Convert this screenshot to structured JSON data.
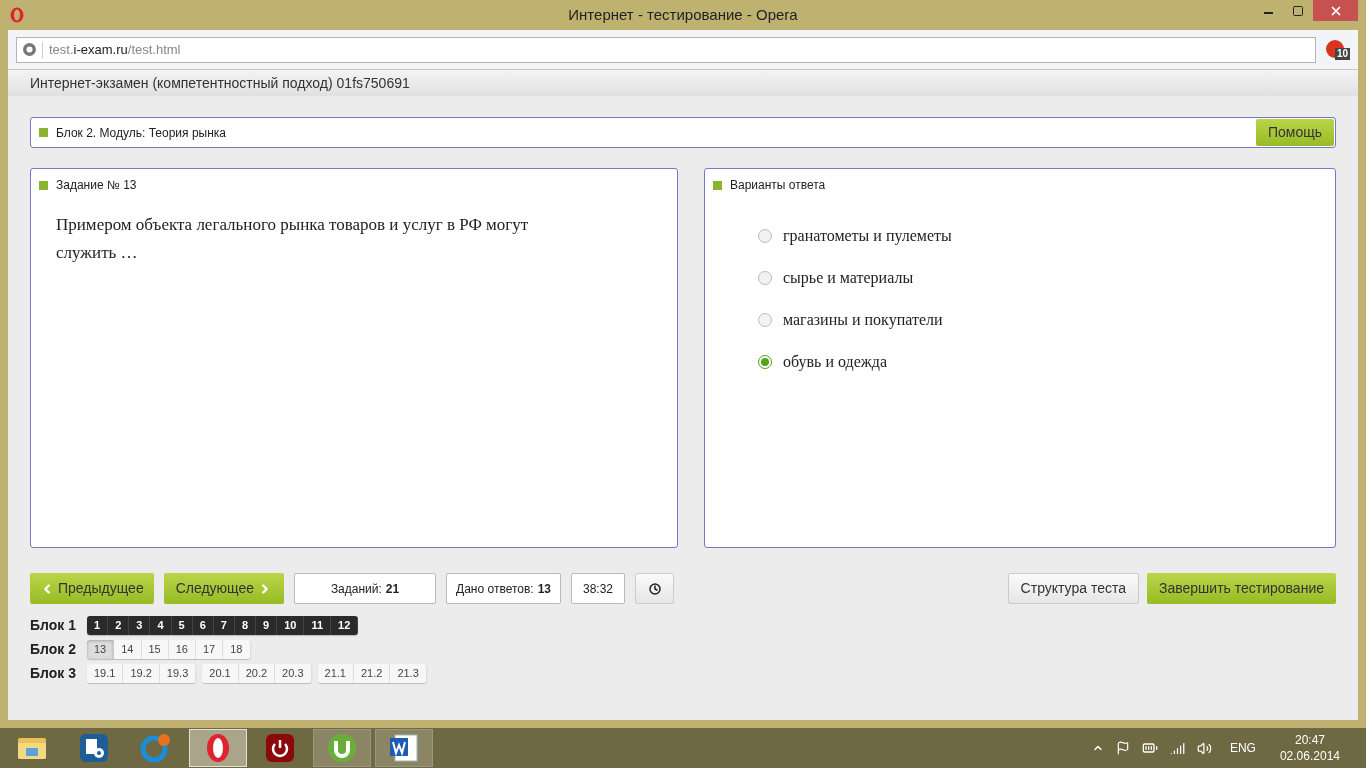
{
  "window": {
    "title": "Интернет - тестирование - Opera"
  },
  "address_bar": {
    "prefix": "test.",
    "domain": "i-exam.ru",
    "path": "/test.html"
  },
  "extension_badge": "10",
  "page_header": "Интернет-экзамен (компетентностный подход) 01fs750691",
  "module_bar": {
    "title": "Блок 2. Модуль: Теория рынка",
    "help_button": "Помощь"
  },
  "task": {
    "title": "Задание № 13",
    "question": "Примером объекта легального рынка товаров и услуг в РФ могут служить …"
  },
  "answers": {
    "title": "Варианты ответа",
    "options": [
      {
        "label": "гранатометы и пулеметы",
        "selected": false
      },
      {
        "label": "сырье и материалы",
        "selected": false
      },
      {
        "label": "магазины и покупатели",
        "selected": false
      },
      {
        "label": "обувь и одежда",
        "selected": true
      }
    ]
  },
  "toolbar": {
    "prev": "Предыдущее",
    "next": "Следующее",
    "tasks_label": "Заданий:",
    "tasks_value": "21",
    "answered_label": "Дано ответов:",
    "answered_value": "13",
    "timer": "38:32",
    "structure": "Структура теста",
    "finish": "Завершить тестирование"
  },
  "blocks": [
    {
      "label": "Блок 1",
      "groups": [
        {
          "items": [
            {
              "label": "1",
              "answered": true,
              "selected": false
            },
            {
              "label": "2",
              "answered": true,
              "selected": false
            },
            {
              "label": "3",
              "answered": true,
              "selected": false
            },
            {
              "label": "4",
              "answered": true,
              "selected": false
            },
            {
              "label": "5",
              "answered": true,
              "selected": false
            },
            {
              "label": "6",
              "answered": true,
              "selected": false
            },
            {
              "label": "7",
              "answered": true,
              "selected": false
            },
            {
              "label": "8",
              "answered": true,
              "selected": false
            },
            {
              "label": "9",
              "answered": true,
              "selected": false
            },
            {
              "label": "10",
              "answered": true,
              "selected": false
            },
            {
              "label": "11",
              "answered": true,
              "selected": false
            },
            {
              "label": "12",
              "answered": true,
              "selected": false
            }
          ]
        }
      ]
    },
    {
      "label": "Блок 2",
      "groups": [
        {
          "items": [
            {
              "label": "13",
              "answered": false,
              "selected": true
            },
            {
              "label": "14",
              "answered": false,
              "selected": false
            },
            {
              "label": "15",
              "answered": false,
              "selected": false
            },
            {
              "label": "16",
              "answered": false,
              "selected": false
            },
            {
              "label": "17",
              "answered": false,
              "selected": false
            },
            {
              "label": "18",
              "answered": false,
              "selected": false
            }
          ]
        }
      ]
    },
    {
      "label": "Блок 3",
      "groups": [
        {
          "items": [
            {
              "label": "19.1",
              "answered": false,
              "selected": false
            },
            {
              "label": "19.2",
              "answered": false,
              "selected": false
            },
            {
              "label": "19.3",
              "answered": false,
              "selected": false
            }
          ]
        },
        {
          "items": [
            {
              "label": "20.1",
              "answered": false,
              "selected": false
            },
            {
              "label": "20.2",
              "answered": false,
              "selected": false
            },
            {
              "label": "20.3",
              "answered": false,
              "selected": false
            }
          ]
        },
        {
          "items": [
            {
              "label": "21.1",
              "answered": false,
              "selected": false
            },
            {
              "label": "21.2",
              "answered": false,
              "selected": false
            },
            {
              "label": "21.3",
              "answered": false,
              "selected": false
            }
          ]
        }
      ]
    }
  ],
  "taskbar": {
    "apps": [
      {
        "kind": "folder",
        "running": false,
        "selected": false
      },
      {
        "kind": "control",
        "running": false,
        "selected": false
      },
      {
        "kind": "cleaner",
        "running": false,
        "selected": false
      },
      {
        "kind": "opera",
        "running": true,
        "selected": true
      },
      {
        "kind": "power",
        "running": false,
        "selected": false
      },
      {
        "kind": "torrent",
        "running": true,
        "selected": false
      },
      {
        "kind": "word",
        "running": true,
        "selected": false
      }
    ],
    "language": "ENG",
    "time": "20:47",
    "date": "02.06.2014"
  }
}
